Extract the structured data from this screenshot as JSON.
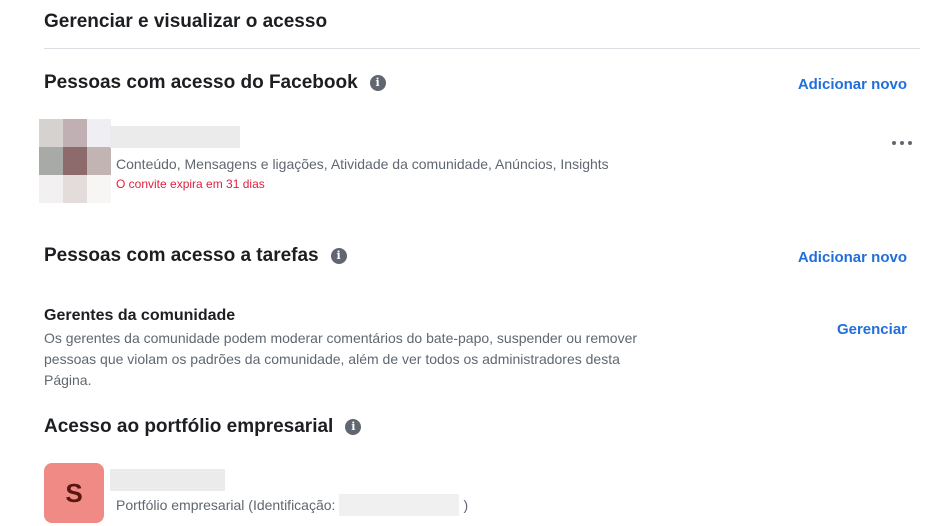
{
  "page": {
    "title": "Gerenciar e visualizar o acesso"
  },
  "facebook_access": {
    "title": "Pessoas com acesso do Facebook",
    "info_icon": "info-icon",
    "add_label": "Adicionar novo",
    "person": {
      "permissions": "Conteúdo, Mensagens e ligações, Atividade da comunidade, Anúncios, Insights",
      "invite_status": "O convite expira em 31 dias",
      "more_icon": "more-horizontal-icon",
      "avatar_colors": [
        "#d6d2d0",
        "#c0b0b4",
        "#eeeef3",
        "#a7aaa7",
        "#8d6a6b",
        "#c3b4b4",
        "#f2f0f0",
        "#e3dcdb",
        "#f8f5f5"
      ]
    }
  },
  "task_access": {
    "title": "Pessoas com acesso a tarefas",
    "info_icon": "info-icon",
    "add_label": "Adicionar novo",
    "community_managers": {
      "title": "Gerentes da comunidade",
      "description": "Os gerentes da comunidade podem moderar comentários do bate-papo, suspender ou remover pessoas que violam os padrões da comunidade, além de ver todos os administradores desta Página.",
      "manage_label": "Gerenciar"
    }
  },
  "business_portfolio": {
    "title": "Acesso ao portfólio empresarial",
    "info_icon": "info-icon",
    "avatar_letter": "S",
    "avatar_color": "#f08a85",
    "label_prefix": "Portfólio empresarial (Identificação:",
    "label_suffix": ")"
  }
}
